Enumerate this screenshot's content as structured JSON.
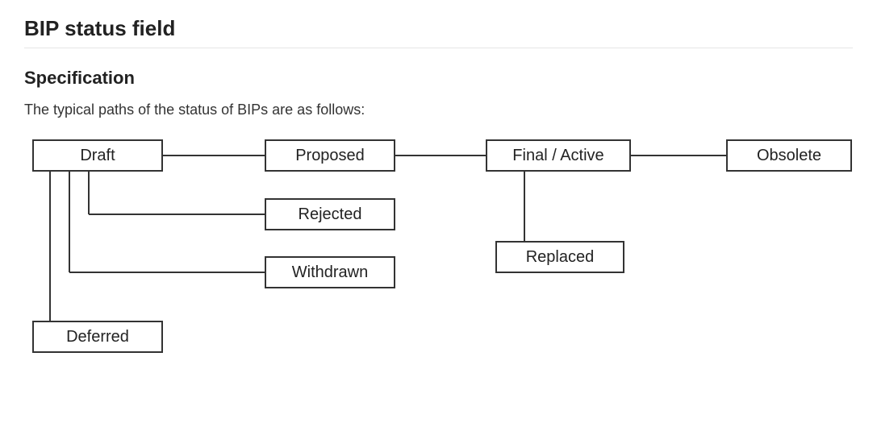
{
  "heading": "BIP status field",
  "subheading": "Specification",
  "lead": "The typical paths of the status of BIPs are as follows:",
  "nodes": {
    "draft": "Draft",
    "proposed": "Proposed",
    "final_active": "Final / Active",
    "obsolete": "Obsolete",
    "rejected": "Rejected",
    "withdrawn": "Withdrawn",
    "replaced": "Replaced",
    "deferred": "Deferred"
  },
  "edges": [
    [
      "Draft",
      "Deferred"
    ],
    [
      "Draft",
      "Rejected"
    ],
    [
      "Draft",
      "Withdrawn"
    ],
    [
      "Draft",
      "Proposed"
    ],
    [
      "Proposed",
      "Final / Active"
    ],
    [
      "Final / Active",
      "Replaced"
    ],
    [
      "Final / Active",
      "Obsolete"
    ]
  ]
}
